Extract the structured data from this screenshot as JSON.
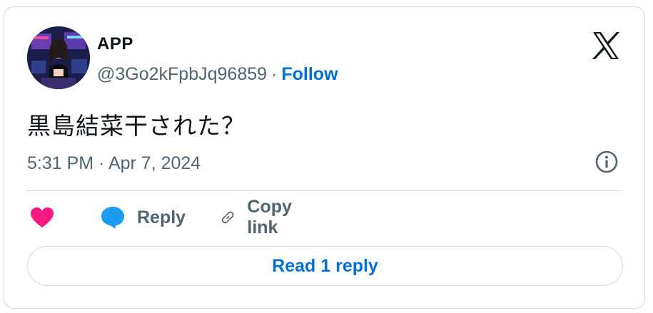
{
  "author": {
    "name": "APP",
    "handle": "@3Go2kFpbJq96859",
    "separator": "·",
    "follow_label": "Follow"
  },
  "tweet": {
    "text": "黒島結菜干された？",
    "timestamp": "5:31 PM · Apr 7, 2024"
  },
  "actions": {
    "like_icon": "heart-icon",
    "reply_label": "Reply",
    "copy_link_label": "Copy link"
  },
  "read_replies_label": "Read 1 reply",
  "colors": {
    "accent": "#006fd6",
    "like": "#f91880",
    "reply_icon": "#1d9bf0",
    "muted_text": "#536471",
    "border": "#cfd9de"
  }
}
